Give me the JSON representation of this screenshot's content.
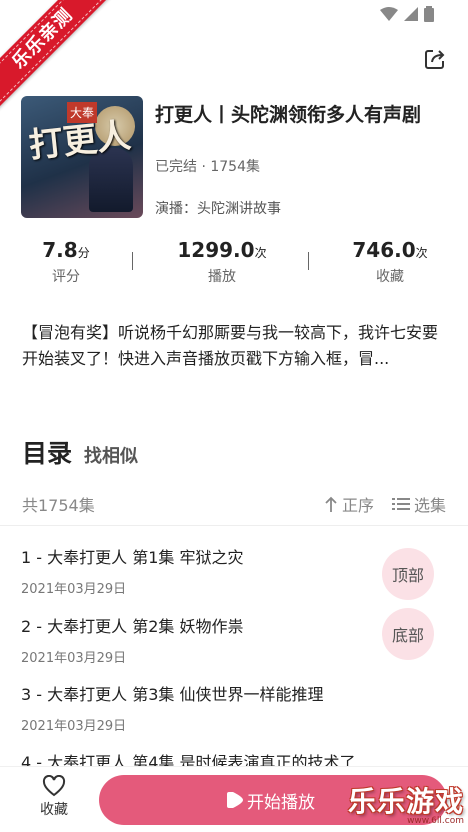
{
  "corner_badge": "乐乐亲测",
  "book": {
    "title": "打更人丨头陀渊领衔多人有声剧",
    "status": "已完结 · 1754集",
    "narrator": "演播：头陀渊讲故事",
    "cover_small_text": "大奉",
    "cover_big_text": "打更人"
  },
  "stats": [
    {
      "value": "7.8",
      "unit": "分",
      "label": "评分"
    },
    {
      "value": "1299.0",
      "unit": "次",
      "label": "播放"
    },
    {
      "value": "746.0",
      "unit": "次",
      "label": "收藏"
    }
  ],
  "description": "【冒泡有奖】听说杨千幻那厮要与我一较高下，我许七安要开始装叉了！快进入声音播放页戳下方输入框，冒...",
  "toc": {
    "title": "目录",
    "similar": "找相似",
    "count": "共1754集",
    "sort_label": "正序",
    "select_label": "选集"
  },
  "episodes": [
    {
      "title": "1 - 大奉打更人 第1集 牢狱之灾",
      "date": "2021年03月29日"
    },
    {
      "title": "2 - 大奉打更人 第2集 妖物作祟",
      "date": "2021年03月29日"
    },
    {
      "title": "3 - 大奉打更人 第3集 仙侠世界一样能推理",
      "date": "2021年03月29日"
    },
    {
      "title": "4 - 大奉打更人 第4集 是时候表演真正的技术了",
      "date": ""
    }
  ],
  "float_buttons": {
    "top": "顶部",
    "bottom": "底部"
  },
  "bottom": {
    "fav_label": "收藏",
    "play_label": "开始播放"
  },
  "watermark": {
    "big": "乐乐游戏",
    "small": "www.6ll.com"
  },
  "colors": {
    "accent": "#e45a7b",
    "float_bg": "#fbe1e6",
    "badge": "#d8192b"
  }
}
